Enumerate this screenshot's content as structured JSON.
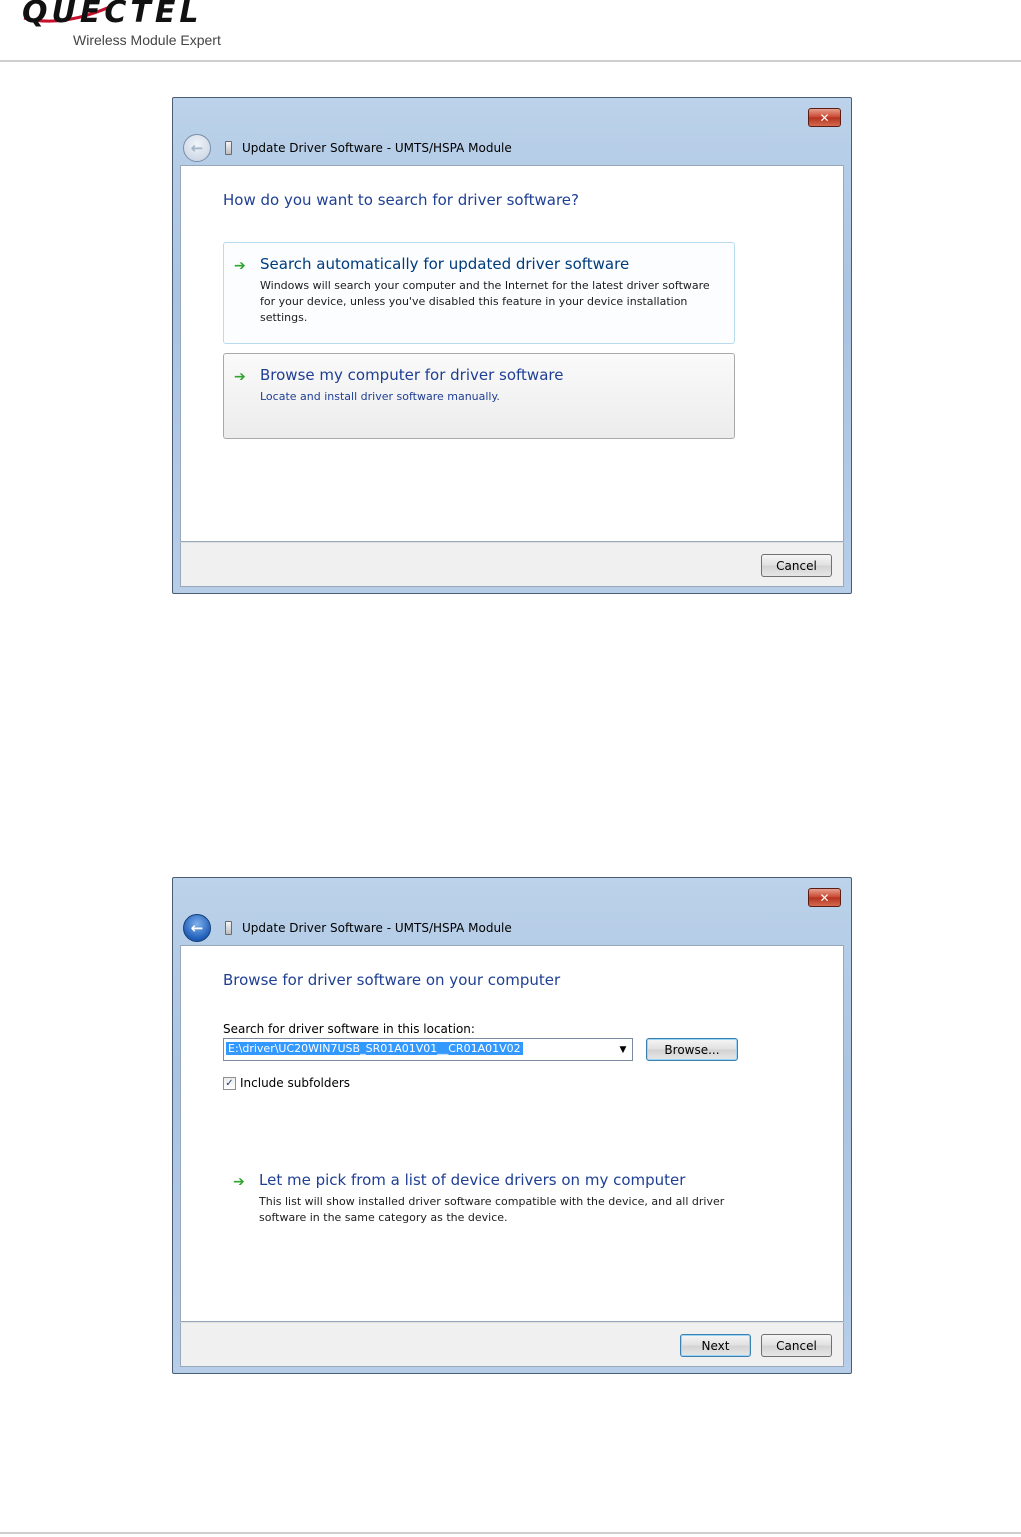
{
  "header": {
    "logo_text": "QUECTEL",
    "tagline": "Wireless Module Expert",
    "accent": "#c8102e"
  },
  "dialog1": {
    "close_label": "✕",
    "back_icon": "back-arrow-icon",
    "title": "Update Driver Software - UMTS/HSPA Module",
    "heading": "How do you want to search for driver software?",
    "options": [
      {
        "title": "Search automatically for updated driver software",
        "desc": "Windows will search your computer and the Internet for the latest driver software for your device, unless you've disabled this feature in your device installation settings."
      },
      {
        "title": "Browse my computer for driver software",
        "desc": "Locate and install driver software manually."
      }
    ],
    "cancel_label": "Cancel"
  },
  "dialog2": {
    "close_label": "✕",
    "title": "Update Driver Software - UMTS/HSPA Module",
    "heading": "Browse for driver software on your computer",
    "location_label": "Search for driver software in this location:",
    "path_value": "E:\\driver\\UC20WIN7USB_SR01A01V01__CR01A01V02",
    "browse_label": "Browse...",
    "include_subfolders_label": "Include subfolders",
    "include_subfolders_checked": true,
    "pick_option": {
      "title": "Let me pick from a list of device drivers on my computer",
      "desc": "This list will show installed driver software compatible with the device, and all driver software in the same category as the device."
    },
    "next_label": "Next",
    "cancel_label": "Cancel"
  }
}
